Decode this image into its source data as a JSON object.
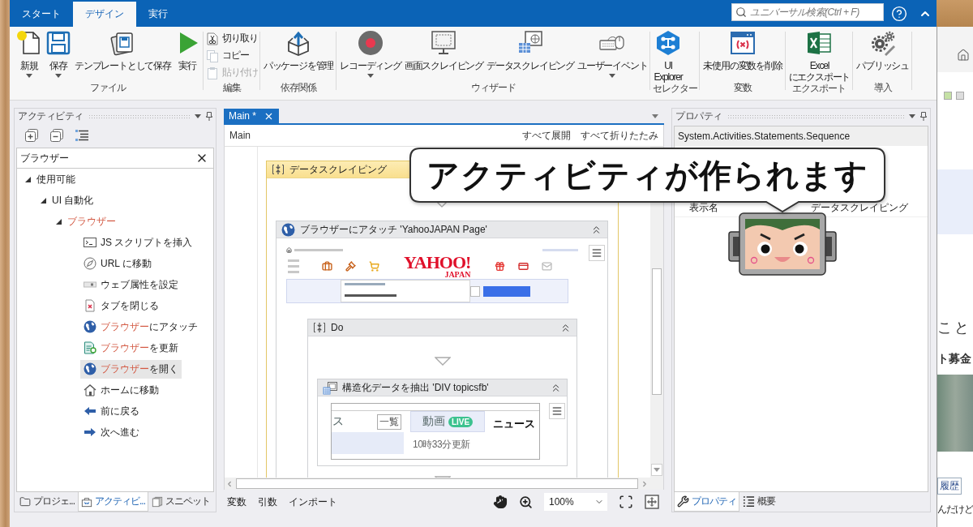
{
  "ribbon": {
    "tabs": [
      {
        "label": "スタート",
        "selected": false
      },
      {
        "label": "デザイン",
        "selected": true
      },
      {
        "label": "実行",
        "selected": false
      }
    ],
    "search": {
      "placeholder": "ユニバーサル検索(Ctrl + F)"
    },
    "groups": [
      {
        "label": "ファイル",
        "kind": "large",
        "items": [
          {
            "kind": "new",
            "lines": [
              "新規"
            ],
            "dropdown": true
          },
          {
            "kind": "save",
            "lines": [
              "保存"
            ],
            "dropdown": true
          },
          {
            "kind": "template",
            "lines": [
              "テンプレートとして保存"
            ],
            "dropdown": false
          },
          {
            "kind": "run",
            "lines": [
              "実行"
            ],
            "dropdown": false
          }
        ]
      },
      {
        "label": "編集",
        "kind": "small",
        "items": [
          {
            "kind": "cut",
            "label": "切り取り",
            "disabled": false
          },
          {
            "kind": "copy",
            "label": "コピー",
            "disabled": false
          },
          {
            "kind": "paste",
            "label": "貼り付け",
            "disabled": true
          }
        ]
      },
      {
        "label": "依存関係",
        "kind": "large",
        "items": [
          {
            "kind": "package",
            "lines": [
              "パッケージを管理"
            ],
            "dropdown": false
          }
        ]
      },
      {
        "label": "ウィザード",
        "kind": "large",
        "items": [
          {
            "kind": "record",
            "lines": [
              "レコーディング"
            ],
            "dropdown": true
          },
          {
            "kind": "screen",
            "lines": [
              "画面スクレイピング"
            ],
            "dropdown": false
          },
          {
            "kind": "data",
            "lines": [
              "データスクレイピング"
            ],
            "dropdown": false
          },
          {
            "kind": "user_event",
            "lines": [
              "ユーザーイベント"
            ],
            "dropdown": true
          }
        ]
      },
      {
        "label": "セレクター",
        "kind": "large",
        "items": [
          {
            "kind": "explorer",
            "lines": [
              "UI",
              "Explorer"
            ],
            "dropdown": false
          }
        ]
      },
      {
        "label": "変数",
        "kind": "large",
        "items": [
          {
            "kind": "variable",
            "lines": [
              "未使用の変数を削除"
            ],
            "dropdown": false
          }
        ]
      },
      {
        "label": "エクスポート",
        "kind": "large",
        "items": [
          {
            "kind": "excel",
            "lines": [
              "Excel",
              "にエクスポート"
            ],
            "dropdown": false
          }
        ]
      },
      {
        "label": "導入",
        "kind": "large",
        "items": [
          {
            "kind": "publish",
            "lines": [
              "パブリッシュ"
            ],
            "dropdown": false
          }
        ]
      }
    ]
  },
  "activities_panel": {
    "title": "アクティビティ",
    "search": {
      "value": "ブラウザー"
    },
    "tree": [
      {
        "parts": [
          {
            "text": "使用可能",
            "match": false
          }
        ],
        "expanded": true,
        "children": [
          {
            "parts": [
              {
                "text": "UI 自動化",
                "match": false
              }
            ],
            "expanded": true,
            "children": [
              {
                "parts": [
                  {
                    "text": "ブラウザー",
                    "match": true
                  }
                ],
                "expanded": true,
                "children": [
                  {
                    "kind": "script",
                    "parts": [
                      {
                        "text": "JS スクリプトを挿入",
                        "match": false
                      }
                    ],
                    "selected": false
                  },
                  {
                    "kind": "compass",
                    "parts": [
                      {
                        "text": "URL に移動",
                        "match": false
                      }
                    ],
                    "selected": false
                  },
                  {
                    "kind": "attribute",
                    "parts": [
                      {
                        "text": "ウェブ属性を設定",
                        "match": false
                      }
                    ],
                    "selected": false
                  },
                  {
                    "kind": "close_tab",
                    "parts": [
                      {
                        "text": "タブを閉じる",
                        "match": false
                      }
                    ],
                    "selected": false
                  },
                  {
                    "kind": "globe",
                    "parts": [
                      {
                        "text": "ブラウザー",
                        "match": true
                      },
                      {
                        "text": "にアタッチ",
                        "match": false
                      }
                    ],
                    "selected": false
                  },
                  {
                    "kind": "refresh",
                    "parts": [
                      {
                        "text": "ブラウザー",
                        "match": true
                      },
                      {
                        "text": "を更新",
                        "match": false
                      }
                    ],
                    "selected": false
                  },
                  {
                    "kind": "globe",
                    "parts": [
                      {
                        "text": "ブラウザー",
                        "match": true
                      },
                      {
                        "text": "を開く",
                        "match": false
                      }
                    ],
                    "selected": true
                  },
                  {
                    "kind": "home",
                    "parts": [
                      {
                        "text": "ホームに移動",
                        "match": false
                      }
                    ],
                    "selected": false
                  },
                  {
                    "kind": "back",
                    "parts": [
                      {
                        "text": "前に戻る",
                        "match": false
                      }
                    ],
                    "selected": false
                  },
                  {
                    "kind": "forward",
                    "parts": [
                      {
                        "text": "次へ進む",
                        "match": false
                      }
                    ],
                    "selected": false
                  }
                ]
              }
            ]
          }
        ]
      }
    ],
    "tabs": [
      {
        "kind": "folder",
        "label": "プロジェ...",
        "selected": false
      },
      {
        "kind": "activities",
        "label": "アクティビ...",
        "selected": true
      },
      {
        "kind": "snippets",
        "label": "スニペット",
        "selected": false
      }
    ]
  },
  "designer": {
    "tabs": [
      {
        "label": "Main *",
        "selected": true
      }
    ],
    "breadcrumb": "Main",
    "actions": [
      "すべて展開",
      "すべて折りたたみ"
    ],
    "workflow": {
      "kind": "sequence",
      "title": "データスクレイピング",
      "selected": true,
      "children": [
        {
          "kind": "browser_activity",
          "title": "ブラウザーにアタッチ 'YahooJAPAN Page'",
          "preview": {
            "kind": "portal",
            "logo": "YAHOO!",
            "logo_sub": "JAPAN"
          },
          "children": [
            {
              "kind": "sequence",
              "title": "Do",
              "selected": false,
              "children": [
                {
                  "kind": "extraction_activity",
                  "title": "構造化データを抽出 'DIV topicsfb'",
                  "preview": {
                    "kind": "topics",
                    "left_tab": "ス",
                    "list_button": "一覧",
                    "video_tab": "動画",
                    "badge": "LIVE",
                    "updated": "10時33分更新",
                    "news": "ニュース"
                  }
                }
              ]
            }
          ]
        }
      ]
    },
    "footer": {
      "tabs": [
        "変数",
        "引数",
        "インポート"
      ],
      "zoom": "100%"
    }
  },
  "properties_panel": {
    "title": "プロパティ",
    "type_name": "System.Activities.Statements.Sequence",
    "rows": [
      {
        "name": "表示名",
        "value": "データスクレイピング"
      }
    ],
    "tabs": [
      {
        "kind": "wrench",
        "label": "プロパティ",
        "selected": true
      },
      {
        "kind": "outline",
        "label": "概要",
        "selected": false
      }
    ]
  },
  "callout": {
    "text": "アクティビティが作られます"
  },
  "background_window": {
    "heading": "こと",
    "subheading": "ト募金",
    "buttons": [
      "履歴"
    ],
    "footer": "んだけど"
  }
}
